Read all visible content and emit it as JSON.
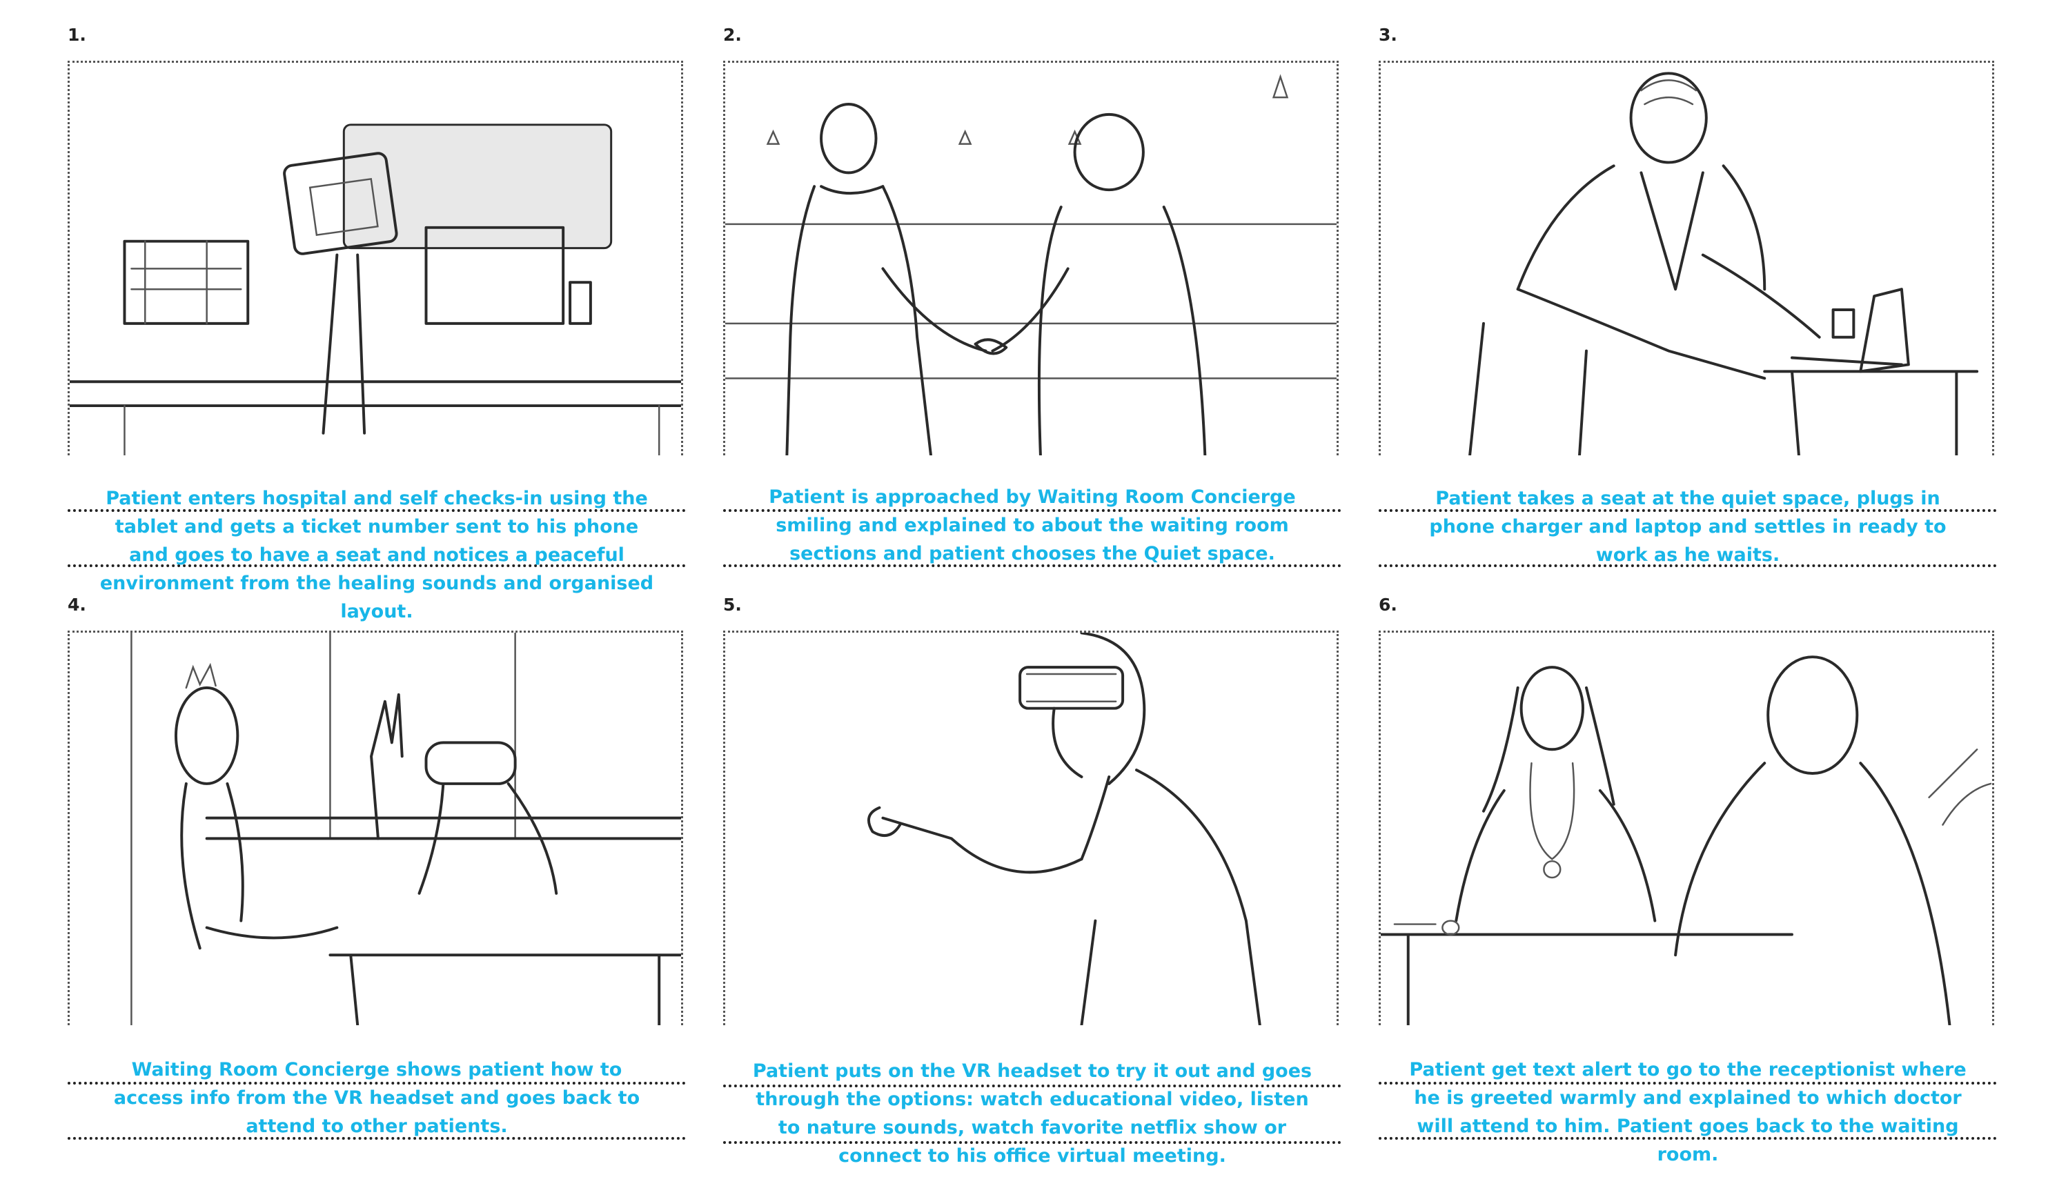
{
  "colors": {
    "caption": "#18b6e8",
    "rule": "#222222",
    "number": "#222222"
  },
  "panels": [
    {
      "number": "1.",
      "illustration": "self-checkin-kiosk",
      "caption": "Patient enters hospital and self checks-in using the tablet and gets a ticket number sent to his phone and goes to have a seat and notices a peaceful environment from the healing sounds and organised layout."
    },
    {
      "number": "2.",
      "illustration": "handshake-concierge",
      "caption": "Patient is approached by Waiting Room Concierge smiling and explained to about the waiting room sections and patient chooses the Quiet space."
    },
    {
      "number": "3.",
      "illustration": "patient-with-laptop",
      "caption": "Patient takes a seat at the quiet space, plugs in phone charger and laptop and settles in ready to work as he waits."
    },
    {
      "number": "4.",
      "illustration": "vr-demonstration",
      "caption": "Waiting Room Concierge  shows patient how to access info from the VR headset and goes back to attend to other patients."
    },
    {
      "number": "5.",
      "illustration": "patient-in-vr-headset",
      "caption": "Patient puts on the VR headset to try it out and goes through the options: watch educational video, listen to nature sounds, watch favorite netflix show or connect to his office virtual meeting."
    },
    {
      "number": "6.",
      "illustration": "doctor-consultation",
      "caption": "Patient get text alert to go to the receptionist where he is greeted warmly and explained to which doctor will attend to him. Patient goes back to the waiting room."
    }
  ]
}
